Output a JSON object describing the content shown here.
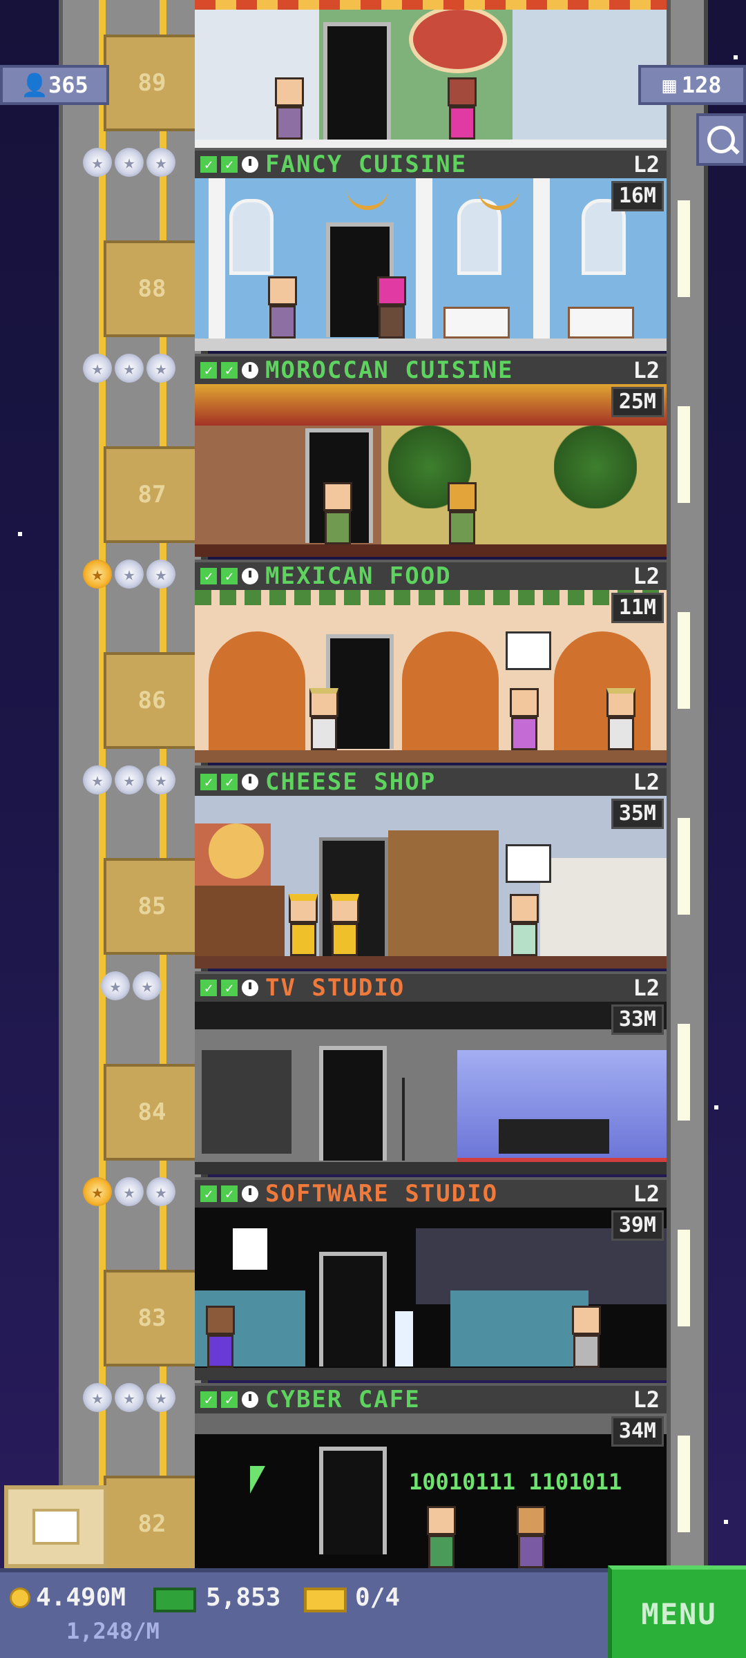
{
  "hud": {
    "population": "365",
    "rooms": "128",
    "coins": "4.490M",
    "coins_rate": "1,248/M",
    "bux": "5,853",
    "tickets": "0/4",
    "menu_label": "MENU"
  },
  "floors": [
    {
      "number": "89",
      "name": "FANCY CUISINE",
      "level": "L2",
      "income": "16M",
      "gold_stars": 0,
      "stars": 3
    },
    {
      "number": "88",
      "name": "MOROCCAN CUISINE",
      "level": "L2",
      "income": "25M",
      "gold_stars": 0,
      "stars": 3
    },
    {
      "number": "87",
      "name": "MEXICAN FOOD",
      "level": "L2",
      "income": "11M",
      "gold_stars": 1,
      "stars": 3
    },
    {
      "number": "86",
      "name": "CHEESE SHOP",
      "level": "L2",
      "income": "35M",
      "gold_stars": 0,
      "stars": 3
    },
    {
      "number": "85",
      "name": "TV STUDIO",
      "level": "L2",
      "income": "33M",
      "gold_stars": 0,
      "stars": 2
    },
    {
      "number": "84",
      "name": "SOFTWARE STUDIO",
      "level": "L2",
      "income": "39M",
      "gold_stars": 1,
      "stars": 3
    },
    {
      "number": "83",
      "name": "CYBER CAFE",
      "level": "L2",
      "income": "34M",
      "gold_stars": 0,
      "stars": 3
    },
    {
      "number": "82"
    }
  ],
  "cyber_cafe_screen_text": "10010111 1101011",
  "colors": {
    "restaurant_label": "#5fd35f",
    "office_label": "#ef7a3c",
    "menu_button": "#2bb13a",
    "hud_bar": "#5b6597"
  },
  "icons": {
    "population": "person-icon",
    "rooms": "building-icon",
    "search": "magnifier-icon",
    "coins": "coin-icon",
    "bux": "bux-icon",
    "tickets": "ticket-icon",
    "bitbook": "box-icon"
  }
}
